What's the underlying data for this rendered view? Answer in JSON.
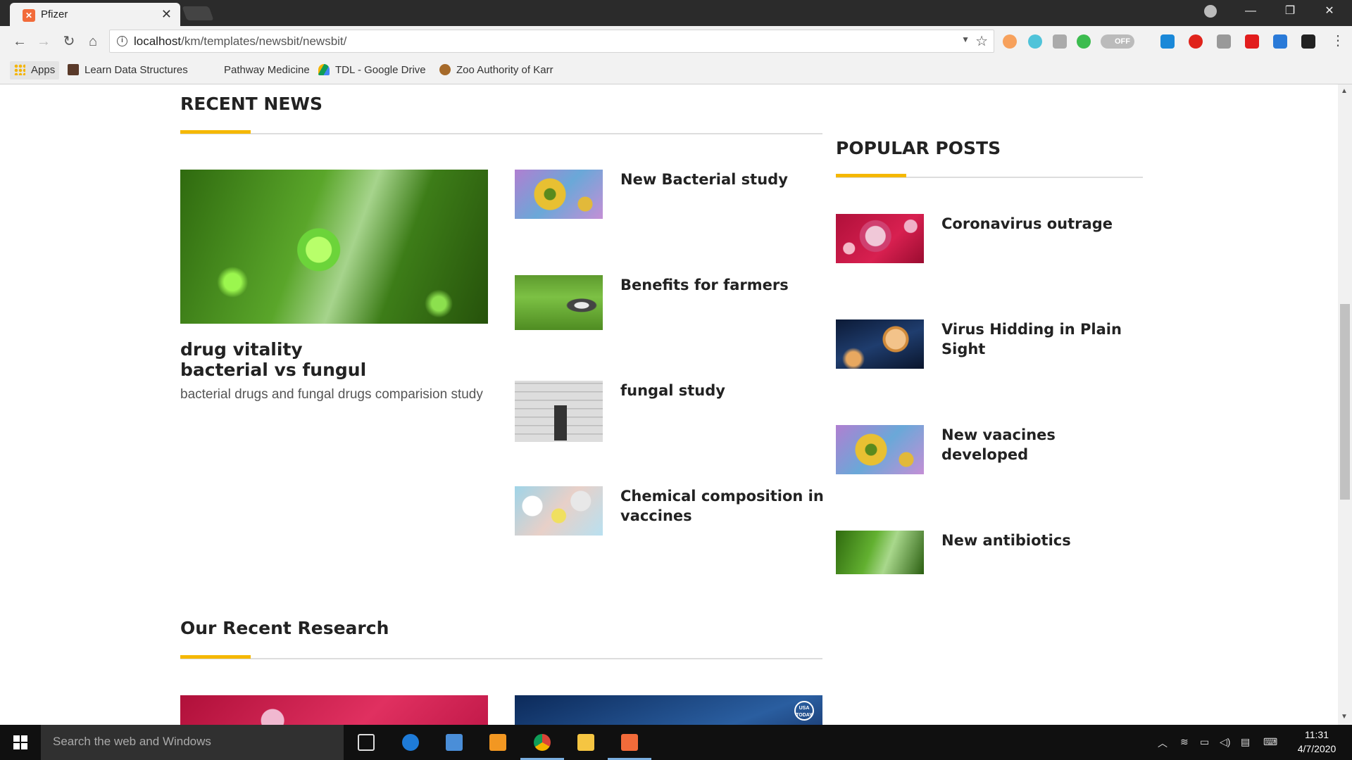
{
  "browser": {
    "tab_title": "Pfizer",
    "url_host": "localhost",
    "url_path": "/km/templates/newsbit/newsbit/",
    "toggle_label": "OFF",
    "bookmarks": [
      {
        "label": "Apps",
        "icon": "apps-grid-icon"
      },
      {
        "label": "Learn Data Structures",
        "icon": "cc-icon"
      },
      {
        "label": "Pathway Medicine",
        "icon": "bookmark-icon"
      },
      {
        "label": "TDL - Google Drive",
        "icon": "google-drive-icon"
      },
      {
        "label": "Zoo Authority of Karr",
        "icon": "emblem-icon"
      }
    ]
  },
  "recent_news": {
    "title": "RECENT NEWS",
    "featured": {
      "title_line1": "drug vitality",
      "title_line2": "bacterial vs fungul",
      "description": "bacterial drugs and fungal drugs comparision study"
    },
    "items": [
      {
        "title": "New Bacterial study"
      },
      {
        "title": "Benefits for farmers"
      },
      {
        "title": "fungal study"
      },
      {
        "title": "Chemical composition in vaccines"
      }
    ]
  },
  "popular_posts": {
    "title": "POPULAR POSTS",
    "items": [
      {
        "title": "Coronavirus outrage"
      },
      {
        "title": "Virus Hidding in Plain Sight"
      },
      {
        "title": "New vaacines developed"
      },
      {
        "title": "New antibiotics"
      }
    ]
  },
  "research": {
    "title": "Our Recent Research",
    "badge": "USA TODAY"
  },
  "taskbar": {
    "search_placeholder": "Search the web and Windows",
    "time": "11:31",
    "date": "4/7/2020"
  },
  "colors": {
    "accent": "#f5b800",
    "heading": "#222222",
    "taskbar": "#101010"
  }
}
